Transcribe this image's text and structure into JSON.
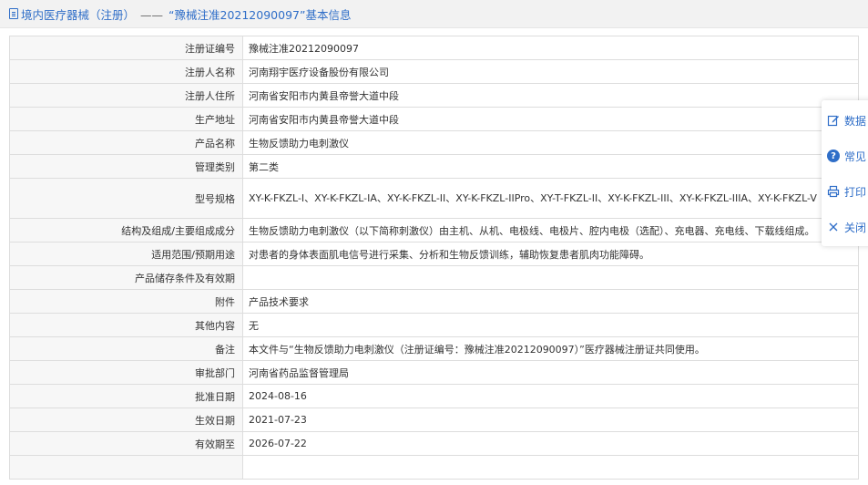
{
  "header": {
    "category": "境内医疗器械（注册）",
    "separator": "——",
    "record_title": "“豫械注准20212090097”基本信息"
  },
  "rows": [
    {
      "label": "注册证编号",
      "value": "豫械注准20212090097"
    },
    {
      "label": "注册人名称",
      "value": "河南翔宇医疗设备股份有限公司"
    },
    {
      "label": "注册人住所",
      "value": "河南省安阳市内黄县帝誉大道中段"
    },
    {
      "label": "生产地址",
      "value": "河南省安阳市内黄县帝誉大道中段"
    },
    {
      "label": "产品名称",
      "value": "生物反馈助力电刺激仪"
    },
    {
      "label": "管理类别",
      "value": "第二类"
    },
    {
      "label": "型号规格",
      "value": "XY-K-FKZL-I、XY-K-FKZL-IA、XY-K-FKZL-II、XY-K-FKZL-IIPro、XY-T-FKZL-II、XY-K-FKZL-III、XY-K-FKZL-IIIA、XY-K-FKZL-V"
    },
    {
      "label": "结构及组成/主要组成成分",
      "value": "生物反馈助力电刺激仪（以下简称刺激仪）由主机、从机、电极线、电极片、腔内电极（选配）、充电器、充电线、下载线组成。"
    },
    {
      "label": "适用范围/预期用途",
      "value": "对患者的身体表面肌电信号进行采集、分析和生物反馈训练，辅助恢复患者肌肉功能障碍。"
    },
    {
      "label": "产品储存条件及有效期",
      "value": ""
    },
    {
      "label": "附件",
      "value": "产品技术要求"
    },
    {
      "label": "其他内容",
      "value": "无"
    },
    {
      "label": "备注",
      "value": "本文件与“生物反馈助力电刺激仪（注册证编号：豫械注准20212090097）”医疗器械注册证共同使用。"
    },
    {
      "label": "审批部门",
      "value": "河南省药品监督管理局"
    },
    {
      "label": "批准日期",
      "value": "2024-08-16"
    },
    {
      "label": "生效日期",
      "value": "2021-07-23"
    },
    {
      "label": "有效期至",
      "value": "2026-07-22"
    },
    {
      "label": "",
      "value": ""
    }
  ],
  "sidebar": {
    "items": [
      {
        "label": "数据",
        "icon": "edit-icon"
      },
      {
        "label": "常见",
        "icon": "help-icon"
      },
      {
        "label": "打印",
        "icon": "print-icon"
      },
      {
        "label": "关闭",
        "icon": "close-icon"
      }
    ]
  },
  "colors": {
    "accent": "#2f6ec8",
    "label_bg": "#f7f7f7",
    "border": "#dddddd",
    "header_bg": "#f2f2f2"
  }
}
